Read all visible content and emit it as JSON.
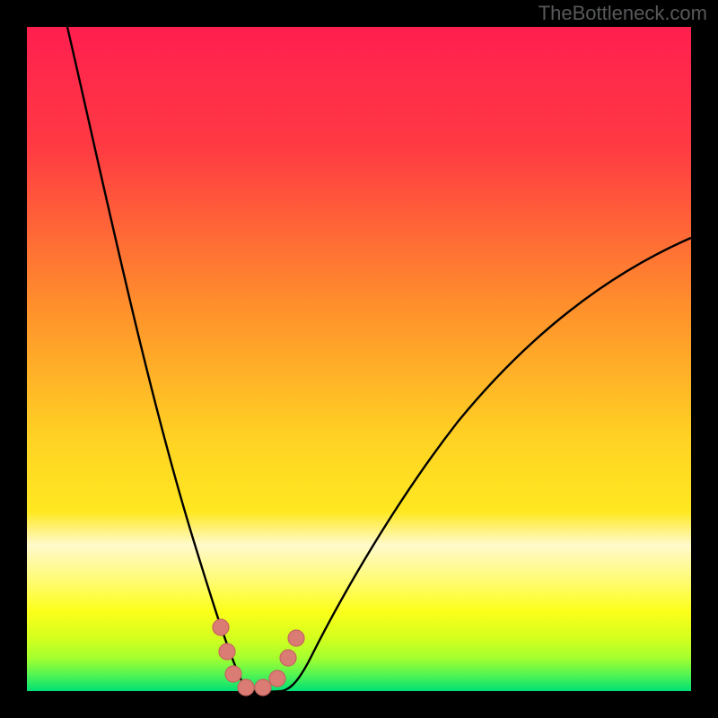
{
  "watermark": "TheBottleneck.com",
  "chart_data": {
    "type": "line",
    "title": "",
    "xlabel": "",
    "ylabel": "",
    "x_range": [
      0,
      100
    ],
    "y_range": [
      0,
      100
    ],
    "series": [
      {
        "name": "left-curve",
        "x": [
          6,
          8,
          10,
          12,
          14,
          16,
          18,
          20,
          22,
          24,
          26,
          28,
          29,
          30,
          31,
          32
        ],
        "y": [
          100,
          93,
          85,
          78,
          70,
          62,
          54,
          46,
          38,
          30,
          22,
          14,
          10,
          6,
          3,
          0
        ]
      },
      {
        "name": "right-curve",
        "x": [
          38,
          39,
          41,
          44,
          48,
          52,
          56,
          60,
          66,
          72,
          78,
          84,
          90,
          96,
          100
        ],
        "y": [
          0,
          3,
          7,
          12,
          18,
          24,
          30,
          35,
          42,
          48,
          53,
          58,
          62,
          66,
          68
        ]
      },
      {
        "name": "bottom-flat",
        "x": [
          32,
          34,
          36,
          38
        ],
        "y": [
          0,
          0,
          0,
          0
        ]
      }
    ],
    "markers": [
      {
        "label": "m1",
        "x": 29.2,
        "y": 9.6
      },
      {
        "label": "m2",
        "x": 30.1,
        "y": 6.0
      },
      {
        "label": "m3",
        "x": 31.1,
        "y": 2.6
      },
      {
        "label": "m4",
        "x": 33.0,
        "y": 0.5
      },
      {
        "label": "m5",
        "x": 35.5,
        "y": 0.5
      },
      {
        "label": "m6",
        "x": 37.7,
        "y": 1.9
      },
      {
        "label": "m7",
        "x": 39.3,
        "y": 5.0
      },
      {
        "label": "m8",
        "x": 40.6,
        "y": 8.0
      }
    ],
    "gradient_bands": [
      {
        "name": "top-red",
        "y_from": 100,
        "y_to": 82,
        "color_from": "#ff1f4f",
        "color_to": "#ff3a43"
      },
      {
        "name": "upper-orange",
        "y_from": 82,
        "y_to": 55,
        "color_from": "#ff3a43",
        "color_to": "#ff8f2c"
      },
      {
        "name": "orange-yellow",
        "y_from": 55,
        "y_to": 30,
        "color_from": "#ff8f2c",
        "color_to": "#ffe821"
      },
      {
        "name": "pale-band",
        "y_from": 30,
        "y_to": 22,
        "color_from": "#ffe821",
        "color_to": "#fffacb"
      },
      {
        "name": "bright-yellow",
        "y_from": 22,
        "y_to": 11,
        "color_from": "#fffacb",
        "color_to": "#fcff19"
      },
      {
        "name": "yellow-green",
        "y_from": 11,
        "y_to": 5,
        "color_from": "#fcff19",
        "color_to": "#a5ff2e"
      },
      {
        "name": "green-edge",
        "y_from": 5,
        "y_to": 0,
        "color_from": "#a5ff2e",
        "color_to": "#00e074"
      }
    ],
    "marker_style": {
      "fill": "#da7b74",
      "stroke": "#c5645f",
      "radius_px": 9
    }
  }
}
